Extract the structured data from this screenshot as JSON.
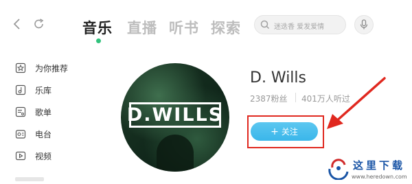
{
  "nav": {
    "back_icon": "chevron-left",
    "refresh_icon": "refresh",
    "tabs": [
      {
        "label": "音乐",
        "active": true
      },
      {
        "label": "直播",
        "active": false
      },
      {
        "label": "听书",
        "active": false
      },
      {
        "label": "探索",
        "active": false
      }
    ],
    "search": {
      "placeholder": "迷迭香 爱发爱情"
    },
    "mic_icon": "microphone"
  },
  "sidebar": {
    "items": [
      {
        "label": "为你推荐",
        "icon": "star-icon"
      },
      {
        "label": "乐库",
        "icon": "music-note-icon"
      },
      {
        "label": "歌单",
        "icon": "playlist-icon"
      },
      {
        "label": "电台",
        "icon": "radio-icon"
      },
      {
        "label": "视频",
        "icon": "video-icon"
      }
    ]
  },
  "artist": {
    "avatar_logo_text": "D.WILLS",
    "name": "D. Wills",
    "fans": "2387粉丝",
    "listened": "401万人听过",
    "follow_label": "关注"
  },
  "watermark": {
    "title": "这里下载",
    "url": "www.heredown.com"
  },
  "colors": {
    "accent_green": "#31c27c",
    "follow_button": "#3ab6ea",
    "annotation_red": "#e0281f"
  }
}
